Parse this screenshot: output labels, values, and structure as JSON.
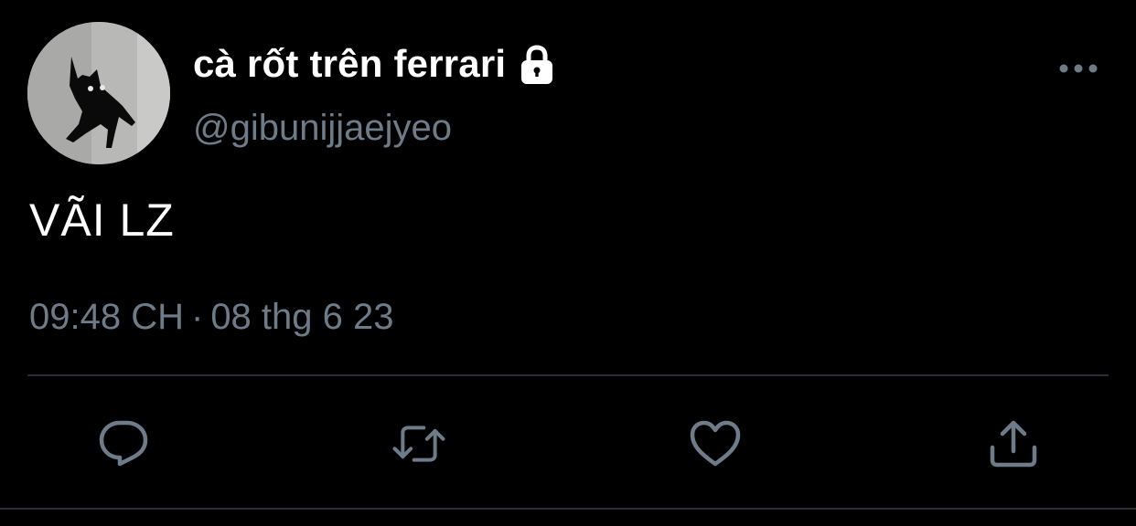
{
  "tweet": {
    "display_name": "cà rốt trên ferrari",
    "handle": "@gibunijjaejyeo",
    "text": "VÃI LZ",
    "time": "09:48 CH",
    "separator": "·",
    "date": "08 thg 6 23"
  },
  "icons": {
    "avatar": "black-cat-avatar",
    "protected": "lock-icon",
    "more": "more-dots-icon",
    "reply": "reply-icon",
    "retweet": "retweet-icon",
    "like": "heart-icon",
    "share": "share-icon"
  },
  "colors": {
    "background": "#000000",
    "primary_text": "#ffffff",
    "secondary_text": "#6e7b88",
    "divider": "#2a2e33"
  }
}
